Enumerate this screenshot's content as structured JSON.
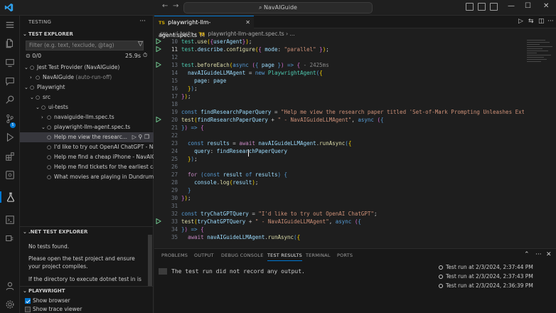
{
  "titlebar": {
    "search": "NavAIGuide",
    "back": "←",
    "forward": "→"
  },
  "sidebar": {
    "header": "TESTING",
    "test_explorer_title": "TEST EXPLORER",
    "filter_placeholder": "Filter (e.g. text, !exclude, @tag)",
    "pass_count": "0/0",
    "duration": "25.9s",
    "tree": [
      {
        "label": "Jest Test Provider (NavAIGuide)",
        "extra": ""
      },
      {
        "label": "NavAIGuide",
        "extra": "(auto-run-off)"
      },
      {
        "label": "Playwright",
        "extra": ""
      },
      {
        "label": "src",
        "extra": ""
      },
      {
        "label": "ui-tests",
        "extra": ""
      },
      {
        "label": "navaiguide-llm.spec.ts",
        "extra": ""
      },
      {
        "label": "playwright-llm-agent.spec.ts",
        "extra": ""
      },
      {
        "label": "Help me view the researc...",
        "extra": ""
      },
      {
        "label": "I'd like to try out OpenAI ChatGPT - Na...",
        "extra": ""
      },
      {
        "label": "Help me find a cheap iPhone - NavAIG...",
        "extra": ""
      },
      {
        "label": "Help me find tickets for the earliest can...",
        "extra": ""
      },
      {
        "label": "What movies are playing in Dundrum ...",
        "extra": ""
      }
    ],
    "net_title": ".NET TEST EXPLORER",
    "net_no_tests": "No tests found.",
    "net_msg1": "Please open the test project and ensure your project compiles.",
    "net_msg2": "If the directory to execute dotnet test in is not the workspace root, consider setting dotnet...",
    "playwright_title": "PLAYWRIGHT",
    "show_browser": "Show browser",
    "show_trace": "Show trace viewer"
  },
  "editor": {
    "tab_label": "playwright-llm-agent.spec.ts",
    "tab_lang": "TS",
    "tab_modified": "M",
    "breadcrumb": [
      "src",
      "ui-tests",
      "playwright-llm-agent.spec.ts",
      "..."
    ],
    "line_numbers": [
      "10",
      "11",
      "12",
      "13",
      "14",
      "15",
      "16",
      "17",
      "18",
      "19",
      "20",
      "21",
      "22",
      "23",
      "24",
      "25",
      "26",
      "27",
      "28",
      "29",
      "30",
      "31",
      "32",
      "33",
      "34",
      "35"
    ],
    "lines": {
      "l10": "test.use({userAgent});",
      "l11": "test.describe.configure({ mode: \"parallel\" });",
      "l13a": "test.beforeEach(async ({ page }) => {",
      "l13b": " - 2425ms",
      "l14": "  navAIGuideLLMAgent = new PlaywrightAgent({",
      "l15": "    page: page",
      "l16": "  });",
      "l17": "});",
      "l19": "const findResearchPaperQuery = \"Help me view the research paper titled 'Set-of-Mark Prompting Unleashes Ext",
      "l20": "test(findResearchPaperQuery + \" - NavAIGuideLLMAgent\", async ({",
      "l21": "}) => {",
      "l23": "  const results = await navAIGuideLLMAgent.runAsync({",
      "l24": "    query: findResearchPaperQuery",
      "l25": "  });",
      "l27": "  for (const result of results) {",
      "l28": "    console.log(result);",
      "l29": "  }",
      "l30": "});",
      "l32": "const tryChatGPTQuery = \"I'd like to try out OpenAI ChatGPT\";",
      "l33": "test(tryChatGPTQuery + \" - NavAIGuideLLMAgent\", async ({",
      "l34": "}) => {",
      "l35": "  await navAIGuideLLMAgent.runAsync({"
    }
  },
  "panel": {
    "tabs": [
      "PROBLEMS",
      "OUTPUT",
      "DEBUG CONSOLE",
      "TEST RESULTS",
      "TERMINAL",
      "PORTS"
    ],
    "active_tab": "TEST RESULTS",
    "message": "The test run did not record any output.",
    "runs": [
      "Test run at 2/3/2024, 2:37:44 PM",
      "Test run at 2/3/2024, 2:37:43 PM",
      "Test run at 2/3/2024, 2:36:39 PM"
    ]
  },
  "colors": {
    "accent": "#0078d4",
    "run_green": "#73c991"
  }
}
